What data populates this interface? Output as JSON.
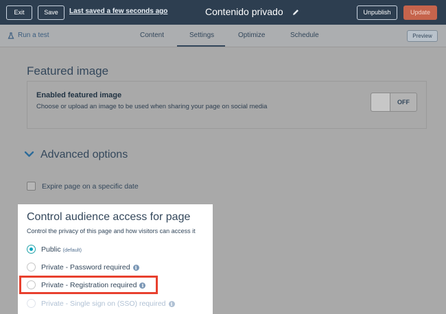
{
  "topbar": {
    "exit_label": "Exit",
    "save_label": "Save",
    "saved_status": "Last saved a few seconds ago",
    "page_title": "Contenido privado",
    "unpublish_label": "Unpublish",
    "update_label": "Update"
  },
  "tabbar": {
    "run_test_label": "Run a test",
    "tabs": [
      "Content",
      "Settings",
      "Optimize",
      "Schedule"
    ],
    "active_tab": "Settings",
    "preview_label": "Preview"
  },
  "featured_image": {
    "heading": "Featured image",
    "title": "Enabled featured image",
    "description": "Choose or upload an image to be used when sharing your page on social media",
    "toggle_label": "OFF"
  },
  "advanced": {
    "heading": "Advanced options",
    "expire_label": "Expire page on a specific date"
  },
  "audience": {
    "heading": "Control audience access for page",
    "description": "Control the privacy of this page and how visitors can access it",
    "options": [
      {
        "label": "Public",
        "suffix": "(default)"
      },
      {
        "label": "Private - Password required"
      },
      {
        "label": "Private - Registration required"
      },
      {
        "label": "Private - Single sign on (SSO) required"
      }
    ],
    "selected": "Public"
  },
  "colors": {
    "topbar_bg": "#2d3e50",
    "update_button": "#c6644c",
    "radio_selected": "#00a4bd",
    "highlight_border": "#e8402e"
  }
}
